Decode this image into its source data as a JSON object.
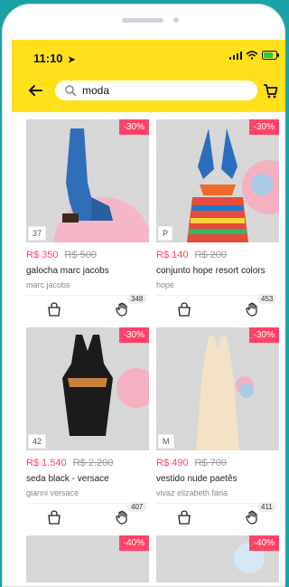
{
  "status": {
    "time": "11:10"
  },
  "search": {
    "value": "moda"
  },
  "products": [
    {
      "discount": "-30%",
      "size": "37",
      "price": "R$ 350",
      "old_price": "R$ 500",
      "title": "galocha marc jacobs",
      "brand": "marc jacobs",
      "likes": "348"
    },
    {
      "discount": "-30%",
      "size": "P",
      "price": "R$ 140",
      "old_price": "R$ 200",
      "title": "conjunto hope resort colors",
      "brand": "hope",
      "likes": "453"
    },
    {
      "discount": "-30%",
      "size": "42",
      "price": "R$ 1.540",
      "old_price": "R$ 2.200",
      "title": "seda black - versace",
      "brand": "gianni versace",
      "likes": "407"
    },
    {
      "discount": "-30%",
      "size": "M",
      "price": "R$ 490",
      "old_price": "R$ 700",
      "title": "vestido nude paetês",
      "brand": "vivaz elizabeth faria",
      "likes": "411"
    },
    {
      "discount": "-40%"
    },
    {
      "discount": "-40%"
    }
  ],
  "colors": {
    "accent": "#ffe01a",
    "sale": "#ff4466",
    "background": "#1aa3a6"
  }
}
